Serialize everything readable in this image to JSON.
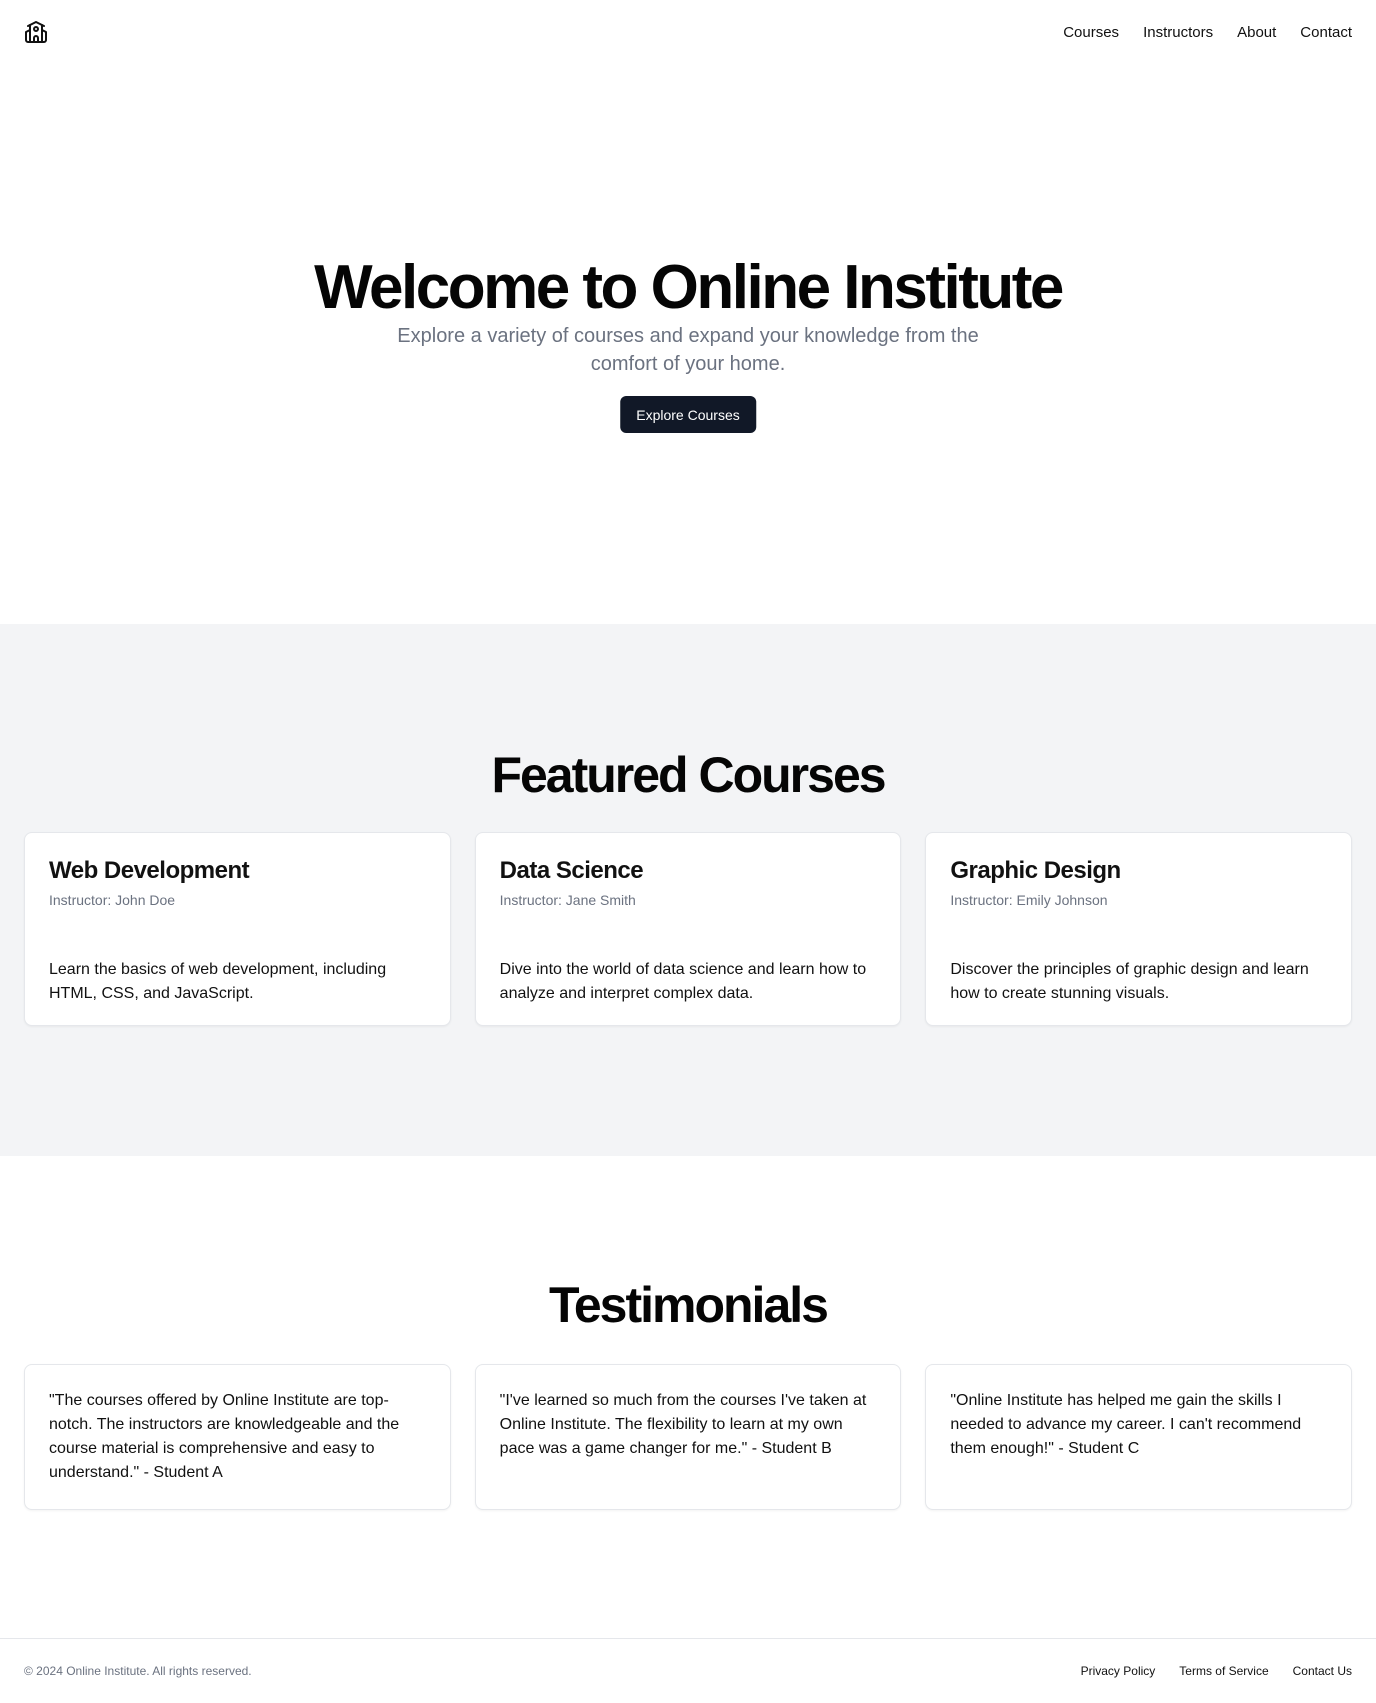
{
  "header": {
    "logo_icon": "school-building-icon",
    "nav": [
      {
        "label": "Courses"
      },
      {
        "label": "Instructors"
      },
      {
        "label": "About"
      },
      {
        "label": "Contact"
      }
    ]
  },
  "hero": {
    "title": "Welcome to Online Institute",
    "subtitle": "Explore a variety of courses and expand your knowledge from the comfort of your home.",
    "button_label": "Explore Courses"
  },
  "featured": {
    "title": "Featured Courses",
    "courses": [
      {
        "title": "Web Development",
        "instructor": "Instructor: John Doe",
        "description": "Learn the basics of web development, including HTML, CSS, and JavaScript."
      },
      {
        "title": "Data Science",
        "instructor": "Instructor: Jane Smith",
        "description": "Dive into the world of data science and learn how to analyze and interpret complex data."
      },
      {
        "title": "Graphic Design",
        "instructor": "Instructor: Emily Johnson",
        "description": "Discover the principles of graphic design and learn how to create stunning visuals."
      }
    ]
  },
  "testimonials": {
    "title": "Testimonials",
    "items": [
      {
        "quote": "\"The courses offered by Online Institute are top-notch. The instructors are knowledgeable and the course material is comprehensive and easy to understand.\" - Student A"
      },
      {
        "quote": "\"I've learned so much from the courses I've taken at Online Institute. The flexibility to learn at my own pace was a game changer for me.\" - Student B"
      },
      {
        "quote": "\"Online Institute has helped me gain the skills I needed to advance my career. I can't recommend them enough!\" - Student C"
      }
    ]
  },
  "footer": {
    "copyright": "© 2024 Online Institute. All rights reserved.",
    "links": [
      {
        "label": "Privacy Policy"
      },
      {
        "label": "Terms of Service"
      },
      {
        "label": "Contact Us"
      }
    ]
  },
  "colors": {
    "button_bg": "#111827",
    "muted_text": "#6b7280",
    "section_bg": "#f3f4f6",
    "border": "#e5e7eb"
  }
}
